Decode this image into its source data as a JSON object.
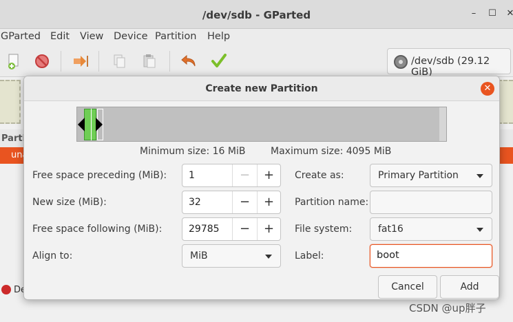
{
  "window": {
    "title": "/dev/sdb - GParted",
    "minimize_glyph": "–",
    "maximize_glyph": "☐",
    "close_glyph": "✕"
  },
  "menubar": {
    "items": [
      "GParted",
      "Edit",
      "View",
      "Device",
      "Partition",
      "Help"
    ]
  },
  "toolbar": {
    "icons": [
      "new-partition-icon",
      "delete-icon",
      "resize-move-icon",
      "copy-icon",
      "paste-icon",
      "undo-icon",
      "apply-icon"
    ],
    "device_selector": "/dev/sdb (29.12 GiB)"
  },
  "background": {
    "partition_header_partial": "Parti",
    "selected_row_partial": "una",
    "status_partial": "De"
  },
  "dialog": {
    "title": "Create new Partition",
    "close_glyph": "✕",
    "min_size_label": "Minimum size: 16 MiB",
    "max_size_label": "Maximum size: 4095 MiB",
    "free_space_preceding_label": "Free space preceding (MiB):",
    "free_space_preceding_value": "1",
    "new_size_label": "New size (MiB):",
    "new_size_value": "32",
    "free_space_following_label": "Free space following (MiB):",
    "free_space_following_value": "29785",
    "align_to_label": "Align to:",
    "align_to_value": "MiB",
    "create_as_label": "Create as:",
    "create_as_value": "Primary Partition",
    "partition_name_label": "Partition name:",
    "partition_name_value": "",
    "file_system_label": "File system:",
    "file_system_value": "fat16",
    "label_label": "Label:",
    "label_value": "boot",
    "minus_glyph": "−",
    "plus_glyph": "+",
    "cancel_label": "Cancel",
    "add_label": "Add"
  },
  "watermark": "CSDN @up胖子",
  "colors": {
    "accent": "#e95420",
    "partition_fill": "#6fce55",
    "unallocated": "#c0c0c0"
  }
}
